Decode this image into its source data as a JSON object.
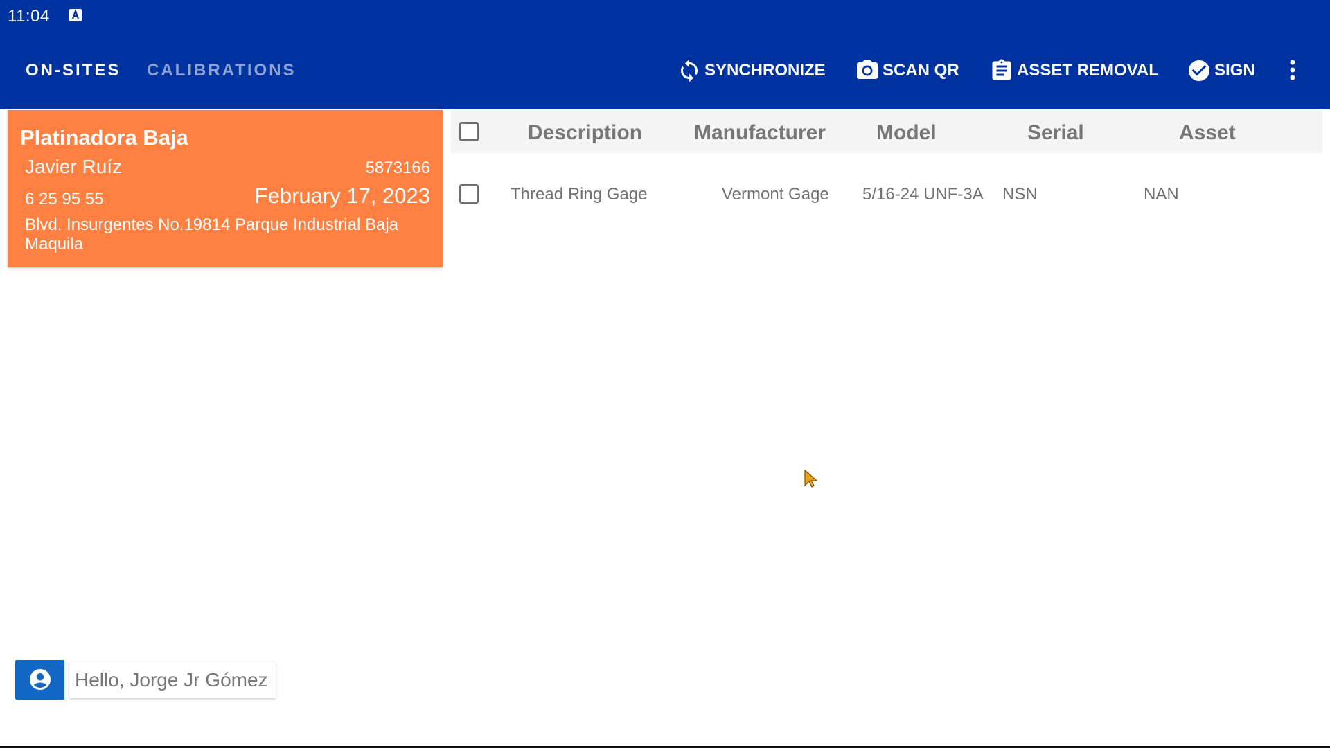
{
  "status_bar": {
    "time": "11:04",
    "indicator_icon": "keyboard-a-icon"
  },
  "tabs": [
    {
      "label": "ON-SITES",
      "active": true
    },
    {
      "label": "CALIBRATIONS",
      "active": false
    }
  ],
  "actions": {
    "sync_label": "SYNCHRONIZE",
    "scan_label": "SCAN QR",
    "removal_label": "ASSET REMOVAL",
    "sign_label": "SIGN"
  },
  "site_card": {
    "name": "Platinadora Baja",
    "contact": "Javier Ruíz",
    "code": "5873166",
    "phone": "6 25 95 55",
    "date": "February 17, 2023",
    "address": "Blvd. Insurgentes No.19814 Parque Industrial Baja Maquila",
    "color": "#ff8040"
  },
  "table": {
    "headers": [
      "Description",
      "Manufacturer",
      "Model",
      "Serial",
      "Asset"
    ],
    "rows": [
      {
        "description": "Thread Ring Gage",
        "manufacturer": "Vermont Gage",
        "model": "5/16-24 UNF-3A",
        "serial": "NSN",
        "asset": "NAN"
      }
    ]
  },
  "user": {
    "greeting": "Hello, Jorge Jr Gómez"
  },
  "colors": {
    "appbar": "#0033a0",
    "accent": "#ff8040",
    "user_button": "#1266c4"
  }
}
